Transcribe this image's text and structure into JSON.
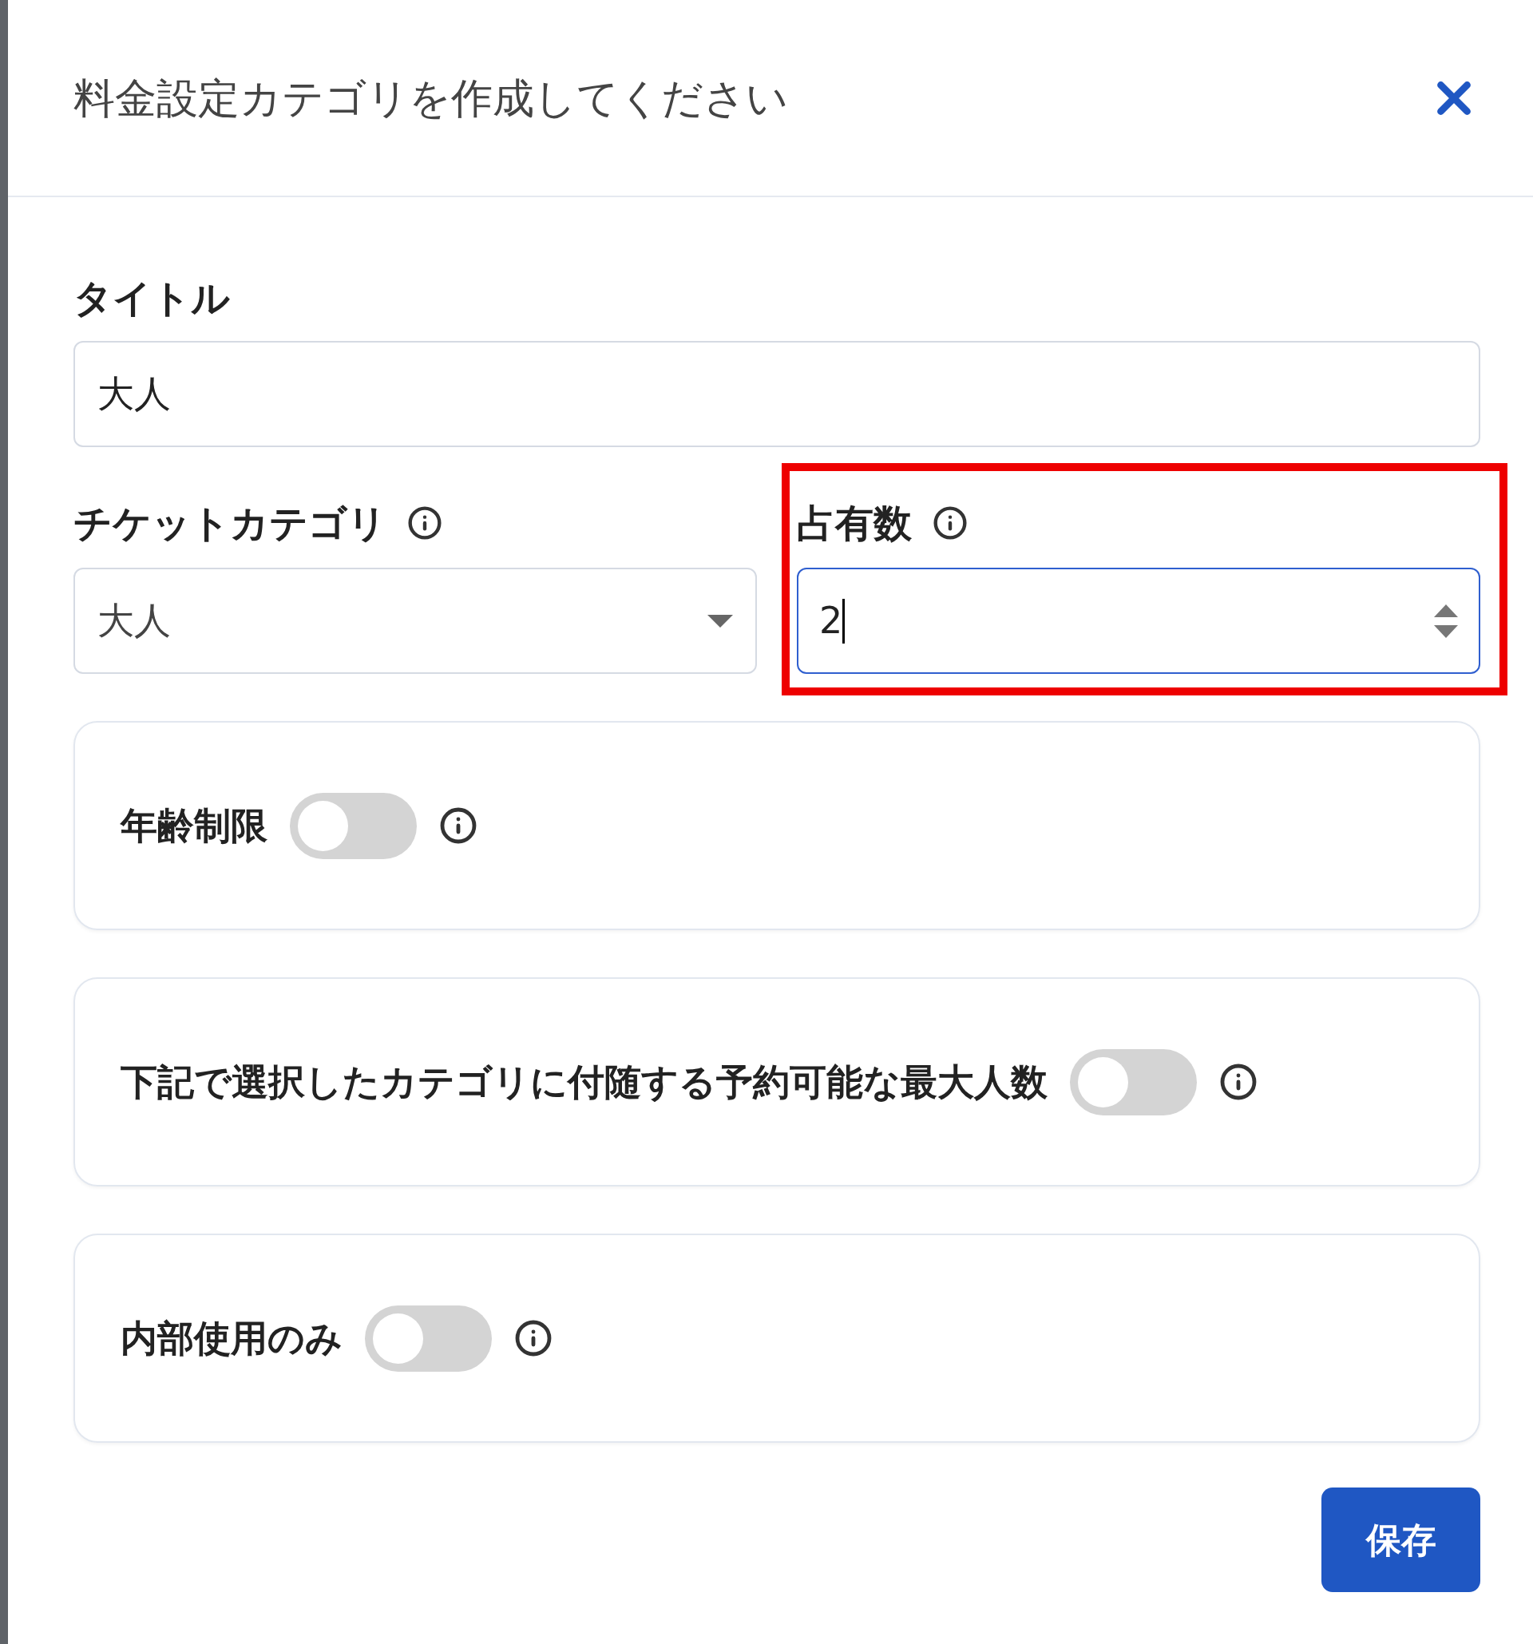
{
  "dialog": {
    "title": "料金設定カテゴリを作成してください"
  },
  "title_field": {
    "label": "タイトル",
    "value": "大人"
  },
  "ticket_category": {
    "label": "チケットカテゴリ",
    "value": "大人"
  },
  "occupancy": {
    "label": "占有数",
    "value": "2",
    "focused": true,
    "highlighted": true
  },
  "toggles": [
    {
      "label": "年齢制限",
      "on": false
    },
    {
      "label": "下記で選択したカテゴリに付随する予約可能な最大人数",
      "on": false
    },
    {
      "label": "内部使用のみ",
      "on": false
    }
  ],
  "save_button": "保存"
}
